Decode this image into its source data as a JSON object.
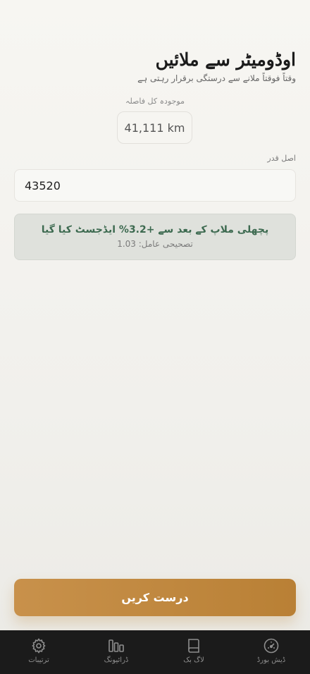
{
  "header": {
    "title": "اوڈومیٹر سے ملائیں",
    "subtitle": "وقتاً فوقتاً ملانے سے درستگی برقرار رہتی ہے"
  },
  "current": {
    "label": "موجودہ کل فاصلہ",
    "value": "41,111 km"
  },
  "actual": {
    "label": "اصل قدر",
    "value": "43520"
  },
  "info": {
    "message": "پچھلی ملاپ کے بعد سے +3.2% ایڈجسٹ کیا گیا",
    "factor": "تصحیحی عامل: 1.03"
  },
  "cta": {
    "label": "درست کریں"
  },
  "tabs": [
    {
      "label": "ترتیبات",
      "icon": "gear-icon"
    },
    {
      "label": "ڈرائیونگ",
      "icon": "bars-icon"
    },
    {
      "label": "لاگ بک",
      "icon": "book-icon"
    },
    {
      "label": "ڈیش بورڈ",
      "icon": "gauge-icon"
    }
  ],
  "colors": {
    "accent": "#c8914b",
    "info_text": "#3d6a50",
    "tabbar": "#1b1b1b"
  }
}
